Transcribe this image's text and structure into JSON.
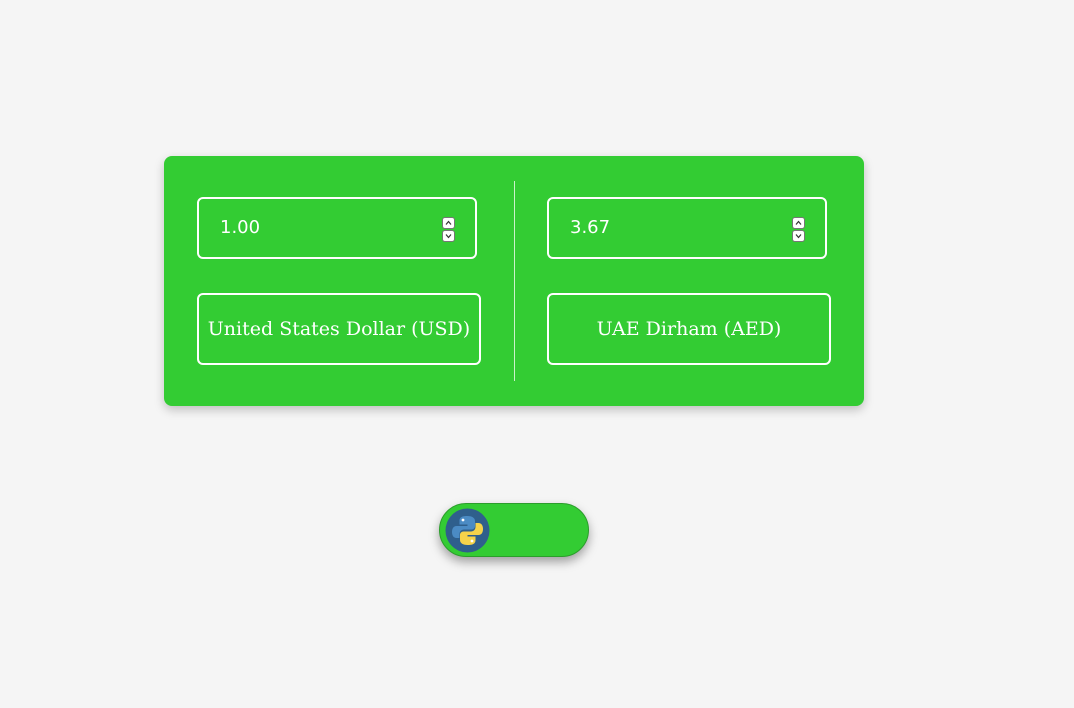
{
  "converter": {
    "from": {
      "amount": "1.00",
      "currency": "United States Dollar (USD)"
    },
    "to": {
      "amount": "3.67",
      "currency": "UAE Dirham (AED)"
    }
  },
  "toggle": {
    "icon": "python-logo-icon",
    "state": "on"
  },
  "colors": {
    "accent": "#33cc33",
    "background": "#f5f5f5",
    "text": "#ffffff"
  }
}
